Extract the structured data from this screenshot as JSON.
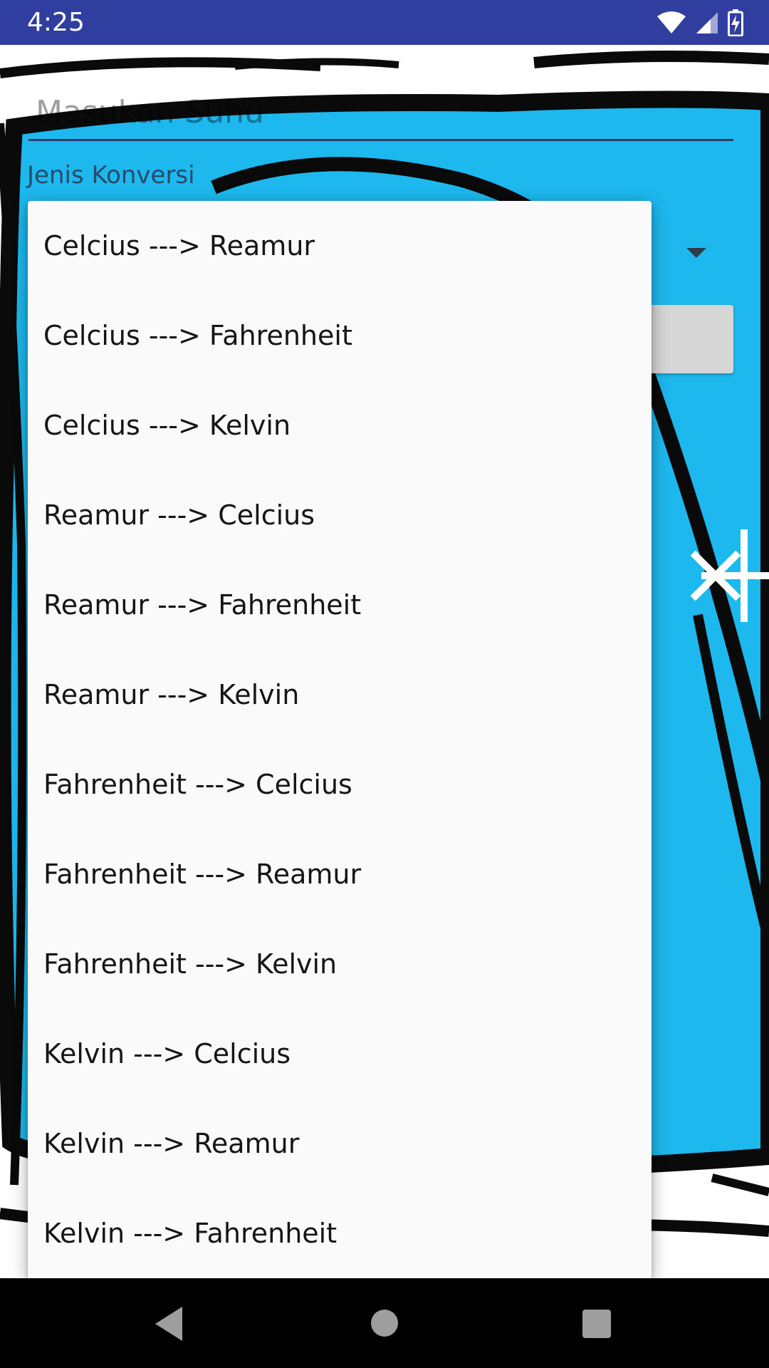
{
  "status_bar": {
    "time": "4:25",
    "icons": [
      "wifi-icon",
      "cellular-signal-icon",
      "battery-charging-icon"
    ],
    "background": "#303F9F"
  },
  "form": {
    "input_placeholder": "Masukan Suhu",
    "conversion_label": "Jenis Konversi"
  },
  "dropdown": {
    "items": [
      "Celcius ---> Reamur",
      "Celcius ---> Fahrenheit",
      "Celcius ---> Kelvin",
      "Reamur ---> Celcius",
      "Reamur ---> Fahrenheit",
      "Reamur ---> Kelvin",
      "Fahrenheit ---> Celcius",
      "Fahrenheit ---> Reamur",
      "Fahrenheit ---> Kelvin",
      "Kelvin ---> Celcius",
      "Kelvin ---> Reamur",
      "Kelvin ---> Fahrenheit"
    ]
  },
  "nav_bar": {
    "icons": [
      "back-icon",
      "home-icon",
      "recents-icon"
    ]
  },
  "colors": {
    "background_blue": "#1DB8EE",
    "outline": "#0a0a0a"
  }
}
